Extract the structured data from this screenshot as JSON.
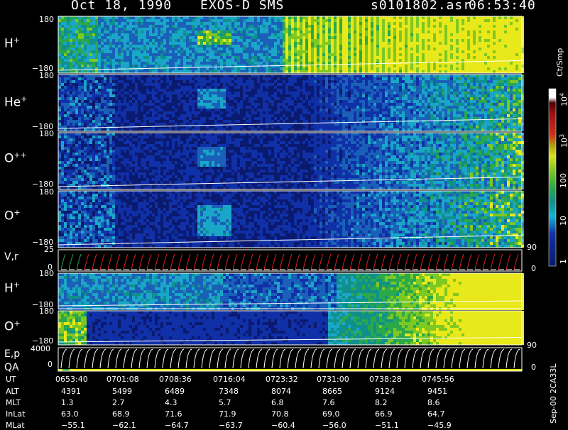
{
  "header": {
    "date_title": "Oct 18, 1990",
    "instrument": "EXOS-D SMS",
    "filename": "s0101802.asr",
    "start_time": "06:53:40"
  },
  "colorbar": {
    "unit": "Ct/Smp",
    "tick_labels": [
      "1",
      "10",
      "100",
      "10",
      "10"
    ],
    "tick_exponents": [
      "",
      "",
      "",
      "3",
      "4"
    ]
  },
  "sidebar_label": "Sep-00 2CA33L",
  "panels": [
    {
      "species": "H",
      "sup": "+",
      "top": "180",
      "bottom": "−180"
    },
    {
      "species": "He",
      "sup": "+",
      "top": "180",
      "bottom": "−180"
    },
    {
      "species": "O",
      "sup": "++",
      "top": "180",
      "bottom": "−180"
    },
    {
      "species": "O",
      "sup": "+",
      "top": "180",
      "bottom": "−180"
    }
  ],
  "vr_panel": {
    "label": "V,r",
    "top": "25",
    "zero": "0",
    "right_top": "90",
    "right_zero": "0"
  },
  "lower_panels": [
    {
      "species": "H",
      "sup": "+",
      "top": "180",
      "bottom": "−180"
    },
    {
      "species": "O",
      "sup": "+",
      "top": "180",
      "bottom": "−180"
    }
  ],
  "ep_panel": {
    "label1": "E,p",
    "label2": "QA",
    "top": "4000",
    "zero": "0",
    "right_top": "90",
    "right_zero": "0"
  },
  "colors": {
    "low": "#0a1a6e",
    "mid": "#1aa6c8",
    "high": "#7ec823",
    "peak": "#e8e81a",
    "red": "#e02020",
    "white": "#ffffff"
  },
  "chart_data": {
    "type": "heatmap",
    "x_axis_label": "UT",
    "ephemeris": {
      "labels": [
        "UT",
        "ALT",
        "MLT",
        "InLat",
        "MLat"
      ],
      "rows": [
        [
          "0653:40",
          "0701:08",
          "0708:36",
          "0716:04",
          "0723:32",
          "0731:00",
          "0738:28",
          "0745:56"
        ],
        [
          "4391",
          "5499",
          "6489",
          "7348",
          "8074",
          "8665",
          "9124",
          "9451"
        ],
        [
          "1.3",
          "2.7",
          "4.3",
          "5.7",
          "6.8",
          "7.6",
          "8.2",
          "8.6"
        ],
        [
          "63.0",
          "68.9",
          "71.6",
          "71.9",
          "70.8",
          "69.0",
          "66.9",
          "64.7"
        ],
        [
          "−55.1",
          "−62.1",
          "−64.7",
          "−63.7",
          "−60.4",
          "−56.0",
          "−51.1",
          "−45.9"
        ]
      ]
    },
    "y_range_angle": [
      -180,
      180
    ],
    "color_scale": "log",
    "color_range": [
      1,
      10000
    ]
  }
}
